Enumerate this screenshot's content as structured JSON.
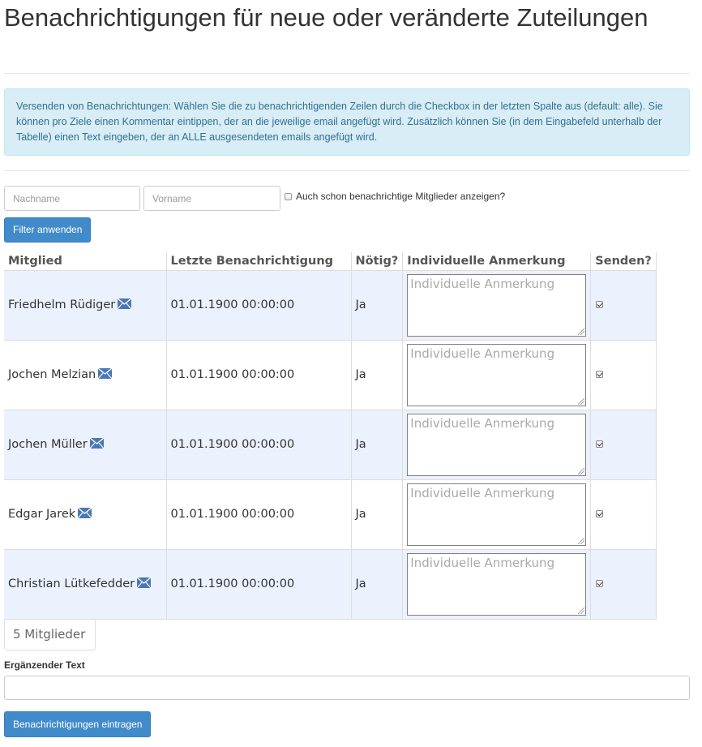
{
  "page": {
    "title": "Benachrichtigungen für neue oder veränderte Zuteilungen"
  },
  "info": {
    "text": "Versenden von Benachrichtungen: Wählen Sie die zu benachrichtigenden Zeilen durch die Checkbox in der letzten Spalte aus (default: alle). Sie können pro Ziele einen Kommentar eintippen, der an die jeweilige email angefügt wird. Zusätzlich können Sie (in dem Eingabefeld unterhalb der Tabelle) einen Text eingeben, der an ALLE ausgesendeten emails angefügt wird."
  },
  "filter": {
    "lastname_placeholder": "Nachname",
    "firstname_placeholder": "Vorname",
    "show_notified_label": "Auch schon benachrichtige Mitglieder anzeigen?",
    "show_notified_checked": false,
    "apply_label": "Filter anwenden"
  },
  "table": {
    "headers": [
      "Mitglied",
      "Letzte Benachrichtigung",
      "Nötig?",
      "Individuelle Anmerkung",
      "Senden?"
    ],
    "note_placeholder": "Individuelle Anmerkung",
    "rows": [
      {
        "member": "Friedhelm Rüdiger",
        "last_notification": "01.01.1900 00:00:00",
        "needed": "Ja",
        "send": true
      },
      {
        "member": "Jochen Melzian",
        "last_notification": "01.01.1900 00:00:00",
        "needed": "Ja",
        "send": true
      },
      {
        "member": "Jochen Müller",
        "last_notification": "01.01.1900 00:00:00",
        "needed": "Ja",
        "send": true
      },
      {
        "member": "Edgar Jarek",
        "last_notification": "01.01.1900 00:00:00",
        "needed": "Ja",
        "send": true
      },
      {
        "member": "Christian Lütkefedder",
        "last_notification": "01.01.1900 00:00:00",
        "needed": "Ja",
        "send": true
      }
    ]
  },
  "summary": {
    "count": "5 Mitglieder"
  },
  "extra": {
    "label": "Ergänzender Text",
    "value": ""
  },
  "submit": {
    "label": "Benachrichtigungen eintragen"
  },
  "colors": {
    "primary": "#428bca",
    "info_bg": "#d9edf7",
    "info_text": "#31708f",
    "odd_row": "#ebf1fd",
    "mail_icon": "#4a78b5"
  },
  "icons": {
    "member_mail": "envelope-icon"
  }
}
